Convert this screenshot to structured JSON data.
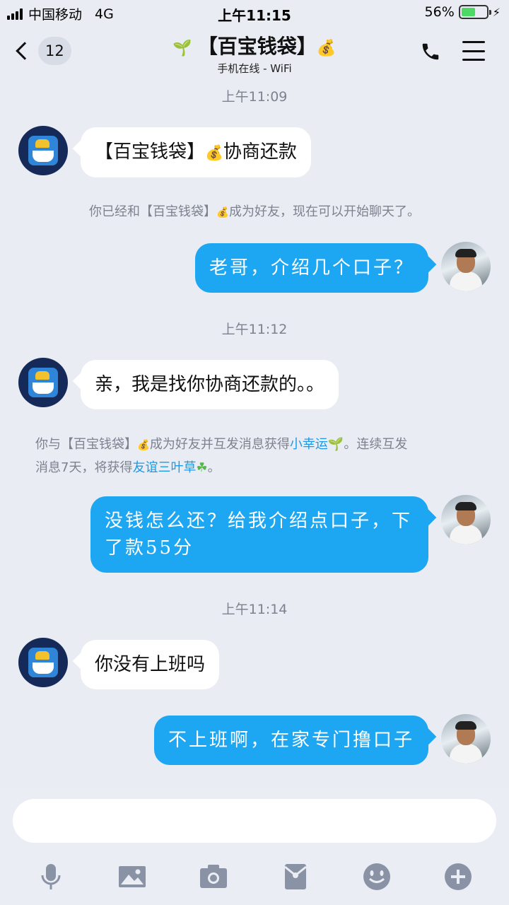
{
  "status_bar": {
    "carrier": "中国移动",
    "network": "4G",
    "time": "上午11:15",
    "battery_percent": "56%",
    "battery_level": 0.56
  },
  "nav": {
    "back_badge": "12",
    "title_text": "【百宝钱袋】",
    "subtitle": "手机在线 - WiFi",
    "icons": [
      "back-chevron-icon",
      "sprout-icon",
      "money-bag-icon",
      "phone-icon",
      "menu-icon"
    ]
  },
  "chat": {
    "timestamps": [
      "上午11:09",
      "上午11:12",
      "上午11:14"
    ],
    "system_msg_1": {
      "part1": "你已经和【百宝钱袋】",
      "part2": "成为好友，现在可以开始聊天了。"
    },
    "system_msg_2": {
      "part1": "你与【百宝钱袋】",
      "part2": "成为好友并互发消息获得",
      "link1": "小幸运",
      "part3": "。连续互发",
      "part4": "消息7天，将获得",
      "link2": "友谊三叶草",
      "part5": "。"
    },
    "messages": [
      {
        "side": "in",
        "text_a": "【百宝钱袋】",
        "text_b": "协商还款"
      },
      {
        "side": "out",
        "text": "老哥，介绍几个口子？"
      },
      {
        "side": "in",
        "text": "亲，我是找你协商还款的。。"
      },
      {
        "side": "out",
        "line1": "没钱怎么还？给我介绍点口子，下",
        "line2": "了款55分"
      },
      {
        "side": "in",
        "text": "你没有上班吗"
      },
      {
        "side": "out",
        "text": "不上班啊，在家专门撸口子"
      }
    ]
  },
  "toolbar_icons": [
    "microphone-icon",
    "image-icon",
    "camera-icon",
    "red-packet-icon",
    "emoji-icon",
    "plus-icon"
  ],
  "colors": {
    "background": "#EAECF3",
    "outgoing_bubble": "#1DA6F2",
    "incoming_bubble": "#FFFFFF",
    "link": "#1A9AE8",
    "meta_text": "#7C8290"
  }
}
